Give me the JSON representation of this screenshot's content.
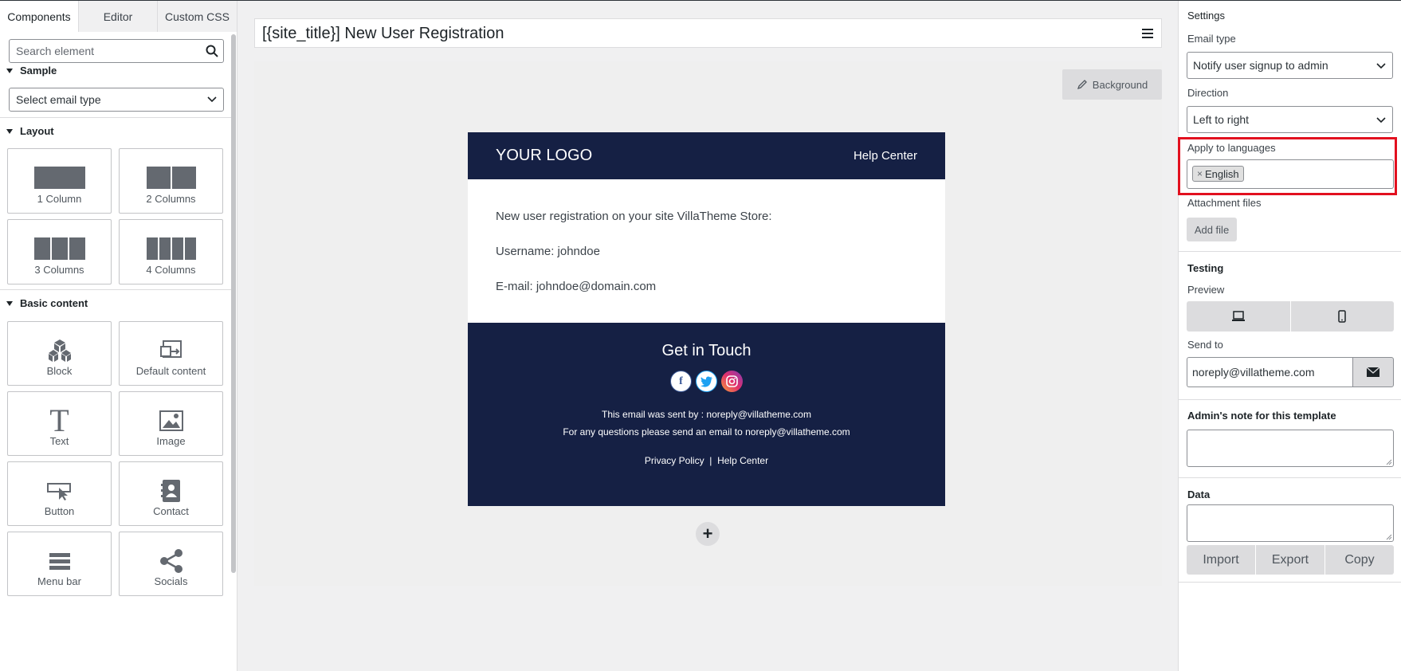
{
  "left_panel": {
    "tabs": [
      "Components",
      "Editor",
      "Custom CSS"
    ],
    "search_placeholder": "Search element",
    "sections": {
      "sample": "Sample",
      "layout": "Layout",
      "basic": "Basic content"
    },
    "sample_select": "Select email type",
    "layout_tiles": [
      "1 Column",
      "2 Columns",
      "3 Columns",
      "4 Columns"
    ],
    "basic_tiles": [
      "Block",
      "Default content",
      "Text",
      "Image",
      "Button",
      "Contact",
      "Menu bar",
      "Socials"
    ]
  },
  "center": {
    "title": "[{site_title}] New User Registration",
    "background_button": "Background",
    "email": {
      "logo": "YOUR LOGO",
      "help_center": "Help Center",
      "body_lines": [
        "New user registration on your site VillaTheme Store:",
        "Username: johndoe",
        "E-mail: johndoe@domain.com"
      ],
      "footer_heading": "Get in Touch",
      "social_icons": [
        "facebook-icon",
        "twitter-icon",
        "instagram-icon"
      ],
      "footer_line1": "This email was sent by : noreply@villatheme.com",
      "footer_line2": "For any questions please send an email to noreply@villatheme.com",
      "privacy": "Privacy Policy",
      "separator": "|",
      "footer_help": "Help Center"
    },
    "add_row": "+"
  },
  "right_panel": {
    "settings_heading": "Settings",
    "email_type_label": "Email type",
    "email_type_value": "Notify user signup to admin",
    "direction_label": "Direction",
    "direction_value": "Left to right",
    "languages_label": "Apply to languages",
    "language_chip": "English",
    "chip_remove": "×",
    "attachment_label": "Attachment files",
    "add_file": "Add file",
    "testing_heading": "Testing",
    "preview_label": "Preview",
    "send_to_label": "Send to",
    "send_to_value": "noreply@villatheme.com",
    "admin_note_heading": "Admin's note for this template",
    "data_heading": "Data",
    "data_buttons": [
      "Import",
      "Export",
      "Copy"
    ]
  },
  "colors": {
    "email_dark": "#152044",
    "highlight": "#e2101f"
  }
}
